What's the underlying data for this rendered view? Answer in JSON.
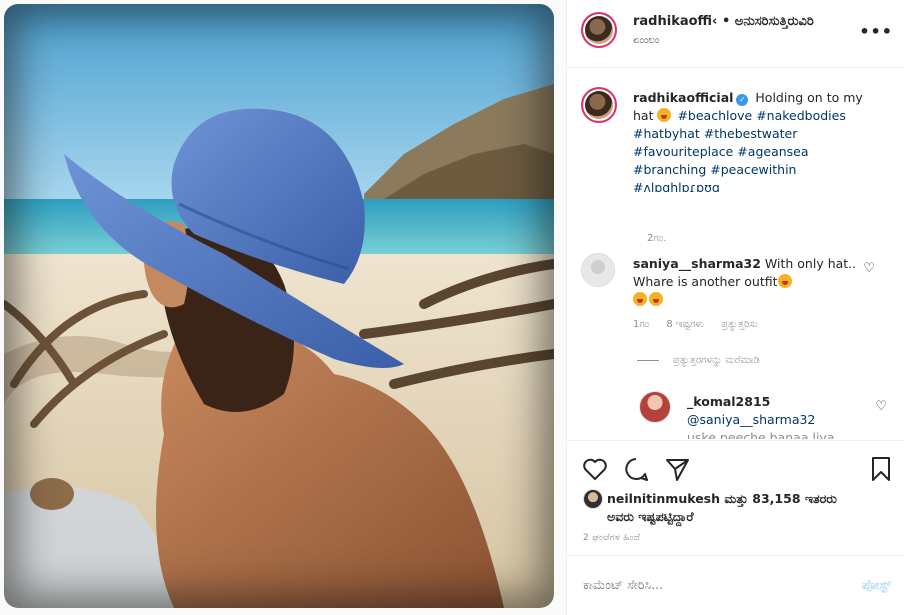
{
  "header": {
    "username": "radhikaoffi‹",
    "follow_label": "• ಅನುಸರಿಸುತ್ತಿರುವಿರಿ",
    "subtitle": "ಏಂಂಲಂ",
    "more_icon": "more-horizontal-icon"
  },
  "caption": {
    "username": "radhikaofficial",
    "text": "Holding on to my hat",
    "hashtags_line1": "#beachlove #nakedbodies",
    "hashtags_line2": "#hatbyhat #thebestwater",
    "hashtags_line3": "#favouriteplace #ageansea",
    "hashtags_line4": "#branching #peacewithin",
    "hashtags_line5": "#ʌlɒɑhlɒɾɒʊɑ",
    "time": "2ಗಂ."
  },
  "comments": [
    {
      "username": "saniya__sharma32",
      "text_line1": "With only",
      "text_line2": "hat.. Whare is another outfit",
      "time": "1ಗಂ",
      "likes": "8 ಇಷ್ಟಗಳು",
      "reply_label": "ಪ್ರತ್ಯುತ್ತರಿಸು"
    }
  ],
  "view_replies": "ಪ್ರತ್ಯುತ್ತರಗಳನ್ನು ಮರೆಮಾಡಿ",
  "reply": {
    "username": "_komal2815",
    "mention": "@saniya__sharma32",
    "text_cut": "uske peeche banaa liya"
  },
  "likes": {
    "liker": "neilnitinmukesh",
    "text": "ಮತ್ತು 83,158 ಇತರರು",
    "text2": "ಅವರು ಇಷ್ಟಪಟ್ಟಿದ್ದಾರೆ"
  },
  "post_time": "2 ಘಂಟೆಗಳ ಹಿಂದೆ",
  "comment_bar": {
    "placeholder": "ಕಾಮೆಂಟ್ ಸೇರಿಸಿ...",
    "post_label": "ಪೋಸ್ಟ್"
  },
  "colors": {
    "accent": "#3897f0",
    "link": "#00376b",
    "muted": "#8e8e8e",
    "post_disabled": "#b2dffc"
  }
}
